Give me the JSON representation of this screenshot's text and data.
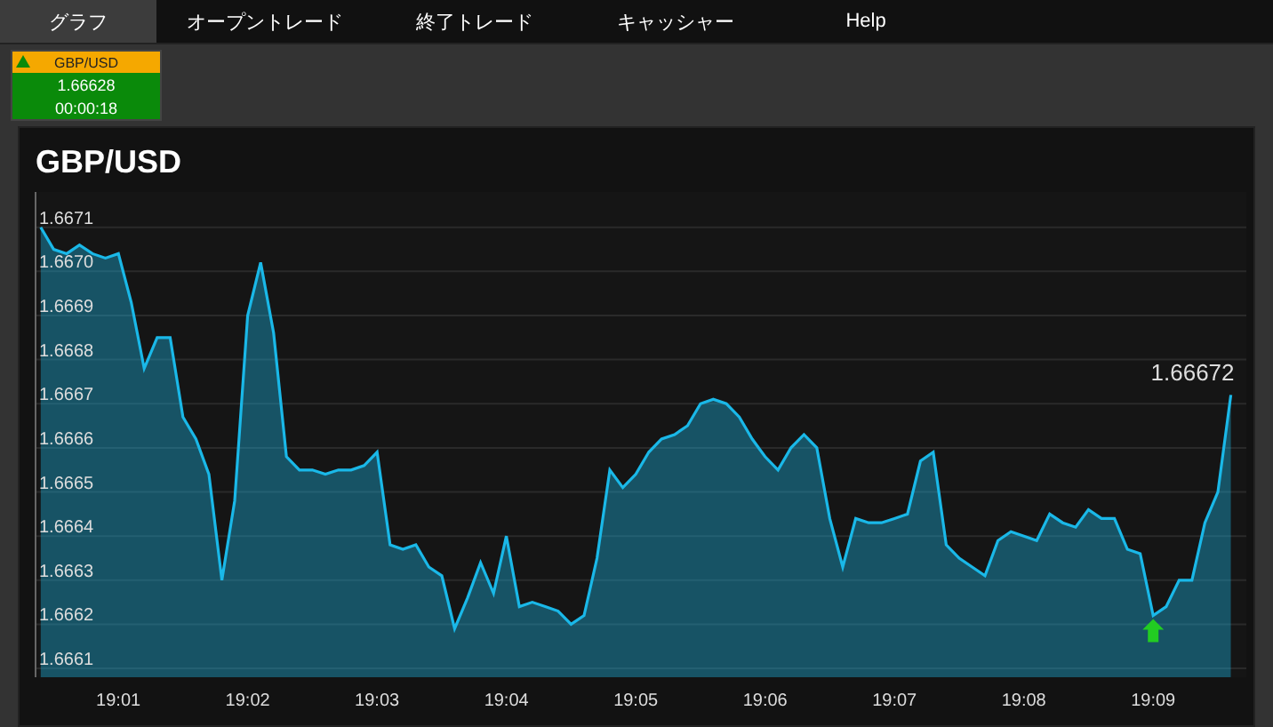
{
  "nav": {
    "tabs": [
      {
        "label": "グラフ",
        "selected": true
      },
      {
        "label": "オープントレード",
        "selected": false
      },
      {
        "label": "終了トレード",
        "selected": false
      },
      {
        "label": "キャッシャー",
        "selected": false
      },
      {
        "label": "Help",
        "selected": false
      }
    ]
  },
  "tickers": [
    {
      "symbol": "GBP/USD",
      "price": "1.66628",
      "timer": "00:00:18"
    }
  ],
  "chart": {
    "chart_data": {
      "type": "area",
      "title": "GBP/USD",
      "categories": [
        null,
        null,
        null,
        null,
        null,
        null,
        "19:01",
        null,
        null,
        null,
        null,
        null,
        null,
        null,
        null,
        null,
        "19:02",
        null,
        null,
        null,
        null,
        null,
        null,
        null,
        null,
        null,
        "19:03",
        null,
        null,
        null,
        null,
        null,
        null,
        null,
        null,
        null,
        "19:04",
        null,
        null,
        null,
        null,
        null,
        null,
        null,
        null,
        null,
        "19:05",
        null,
        null,
        null,
        null,
        null,
        null,
        null,
        null,
        null,
        "19:06",
        null,
        null,
        null,
        null,
        null,
        null,
        null,
        null,
        null,
        "19:07",
        null,
        null,
        null,
        null,
        null,
        null,
        null,
        null,
        null,
        "19:08",
        null,
        null,
        null,
        null,
        null,
        null,
        null,
        null,
        null,
        "19:09",
        null,
        null,
        null,
        null,
        null,
        null
      ],
      "series": [
        {
          "color": "#1ab8e8",
          "values": [
            1.6671,
            1.66705,
            1.66704,
            1.66706,
            1.66704,
            1.66703,
            1.66704,
            1.66693,
            1.66678,
            1.66685,
            1.66685,
            1.66667,
            1.66662,
            1.66654,
            1.6663,
            1.66648,
            1.6669,
            1.66702,
            1.66686,
            1.66658,
            1.66655,
            1.66655,
            1.66654,
            1.66655,
            1.66655,
            1.66656,
            1.66659,
            1.66638,
            1.66637,
            1.66638,
            1.66633,
            1.66631,
            1.66619,
            1.66626,
            1.66634,
            1.66627,
            1.6664,
            1.66624,
            1.66625,
            1.66624,
            1.66623,
            1.6662,
            1.66622,
            1.66635,
            1.66655,
            1.66651,
            1.66654,
            1.66659,
            1.66662,
            1.66663,
            1.66665,
            1.6667,
            1.66671,
            1.6667,
            1.66667,
            1.66662,
            1.66658,
            1.66655,
            1.6666,
            1.66663,
            1.6666,
            1.66644,
            1.66633,
            1.66644,
            1.66643,
            1.66643,
            1.66644,
            1.66645,
            1.66657,
            1.66659,
            1.66638,
            1.66635,
            1.66633,
            1.66631,
            1.66639,
            1.66641,
            1.6664,
            1.66639,
            1.66645,
            1.66643,
            1.66642,
            1.66646,
            1.66644,
            1.66644,
            1.66637,
            1.66636,
            1.66622,
            1.66624,
            1.6663,
            1.6663,
            1.66643,
            1.6665,
            1.66672
          ]
        }
      ],
      "ylim": [
        1.66608,
        1.66718
      ],
      "yticks": [
        {
          "value": 1.6661,
          "label": "1.6661"
        },
        {
          "value": 1.6662,
          "label": "1.6662"
        },
        {
          "value": 1.6663,
          "label": "1.6663"
        },
        {
          "value": 1.6664,
          "label": "1.6664"
        },
        {
          "value": 1.6665,
          "label": "1.6665"
        },
        {
          "value": 1.6666,
          "label": "1.6666"
        },
        {
          "value": 1.6667,
          "label": "1.6667"
        },
        {
          "value": 1.6668,
          "label": "1.6668"
        },
        {
          "value": 1.6669,
          "label": "1.6669"
        },
        {
          "value": 1.667,
          "label": "1.6670"
        },
        {
          "value": 1.6671,
          "label": "1.6671"
        }
      ],
      "grid": true,
      "annotations": [
        "1.66672"
      ]
    }
  }
}
